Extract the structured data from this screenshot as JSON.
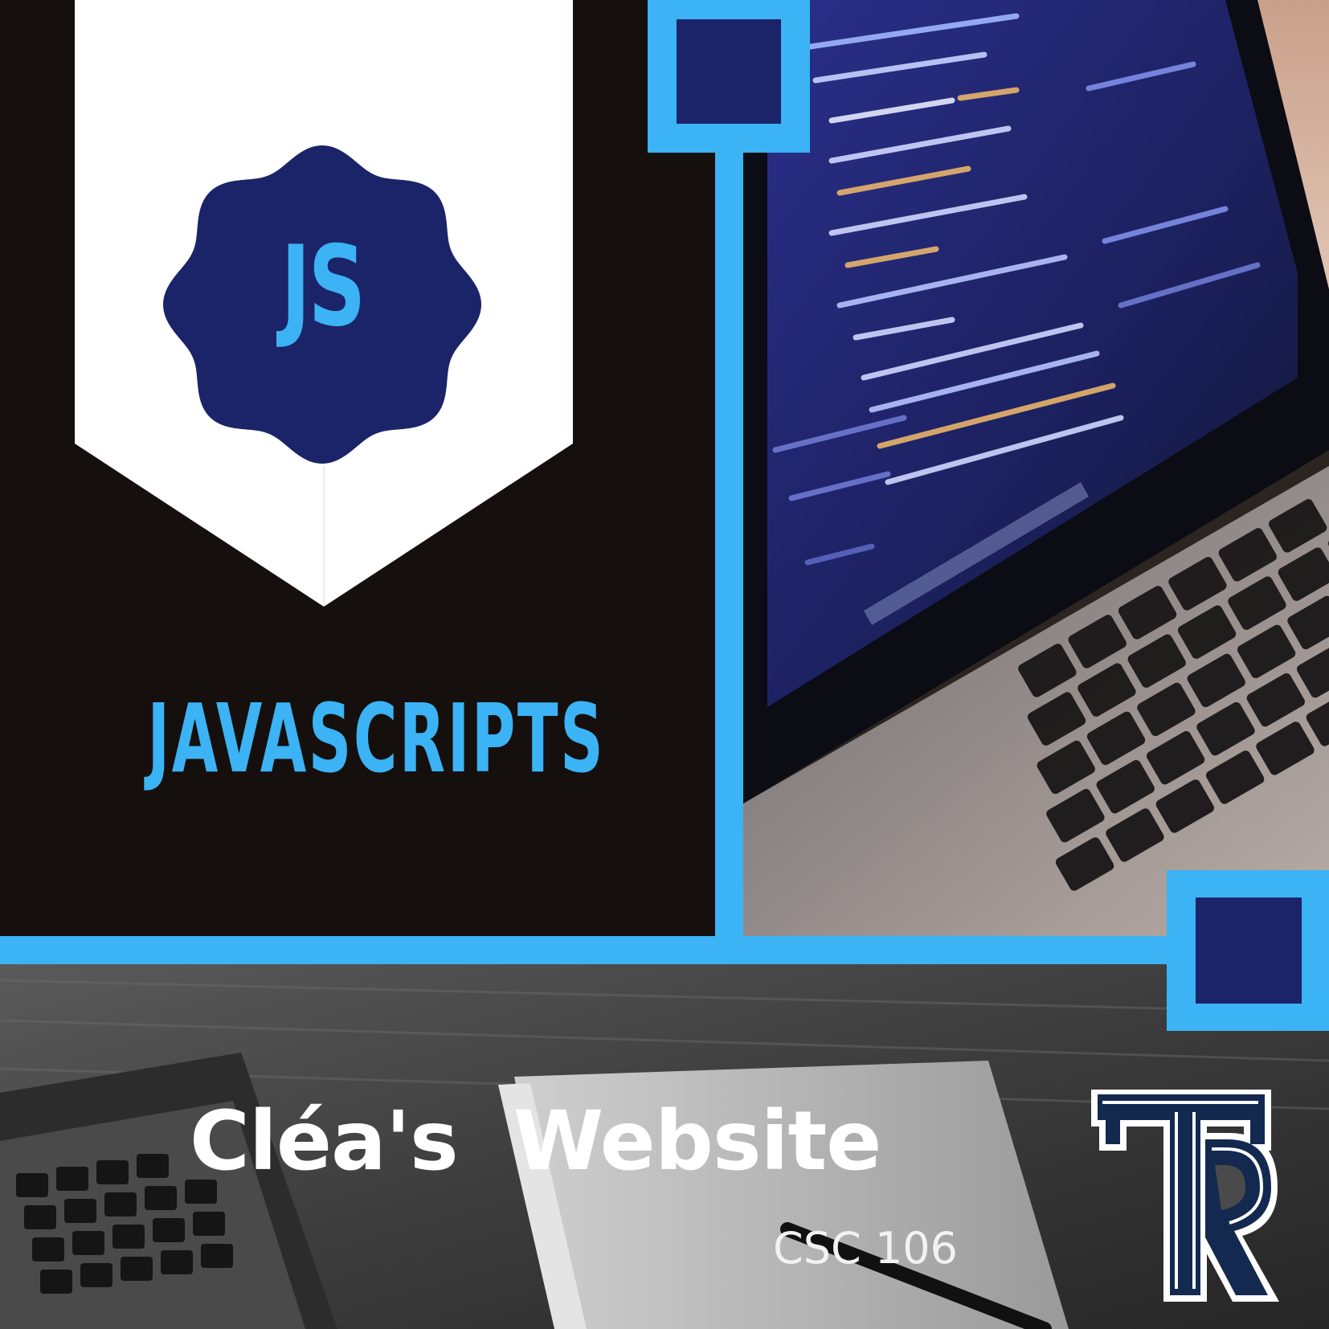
{
  "badge": {
    "label": "JS"
  },
  "heading": {
    "text": "JAVASCRIPTS"
  },
  "site": {
    "title": "Cléa's  Website",
    "course": "CSC 106"
  },
  "colors": {
    "accent": "#3bb3f5",
    "navy": "#1b2469",
    "background": "#150f0d",
    "white": "#ffffff"
  },
  "icons": {
    "badge": "seal-badge-icon",
    "logo": "r-monogram-logo-icon"
  }
}
